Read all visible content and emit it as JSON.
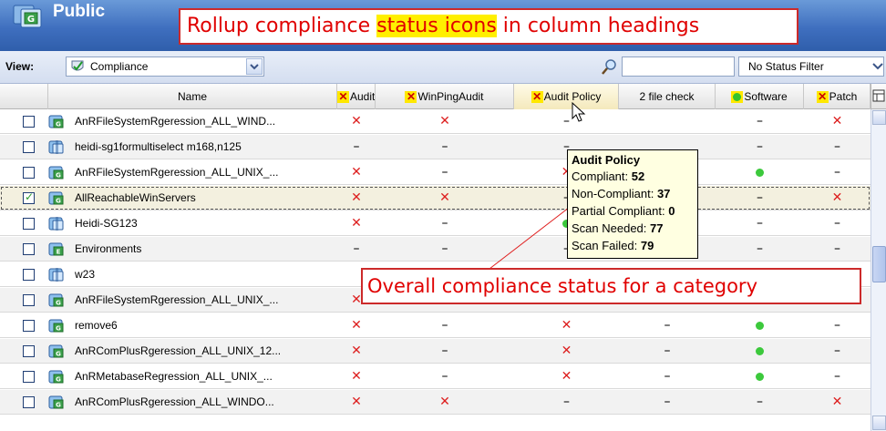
{
  "window": {
    "title": "Public",
    "annotation_top": {
      "before": "Rollup compliance ",
      "highlight": "status icons",
      "after": " in column headings"
    }
  },
  "viewbar": {
    "view_label": "View:",
    "view_value": "Compliance",
    "search_value": "",
    "status_filter": "No Status Filter"
  },
  "columns": [
    {
      "label": "Name",
      "status": "none"
    },
    {
      "label": "Audit",
      "status": "x"
    },
    {
      "label": "WinPingAudit",
      "status": "x"
    },
    {
      "label": "Audit Policy",
      "status": "x"
    },
    {
      "label": "2 file check",
      "status": "none"
    },
    {
      "label": "Software",
      "status": "dot"
    },
    {
      "label": "Patch",
      "status": "x"
    }
  ],
  "rows": [
    {
      "name": "AnRFileSystemRgeression_ALL_WIND...",
      "icon": "group-icon",
      "checked": false,
      "cells": [
        "x",
        "x",
        "-",
        "",
        "-",
        "x"
      ]
    },
    {
      "name": "heidi-sg1formultiselect m168,n125",
      "icon": "smart-group-icon",
      "checked": false,
      "cells": [
        "-",
        "-",
        "-",
        "",
        "-",
        "-"
      ]
    },
    {
      "name": "AnRFileSystemRgeression_ALL_UNIX_...",
      "icon": "group-icon",
      "checked": false,
      "cells": [
        "x",
        "-",
        "x",
        "",
        "dot",
        "-"
      ]
    },
    {
      "name": "AllReachableWinServers",
      "icon": "group-icon",
      "checked": true,
      "cells": [
        "x",
        "x",
        "-",
        "",
        "-",
        "x"
      ]
    },
    {
      "name": "Heidi-SG123",
      "icon": "smart-group-icon",
      "checked": false,
      "cells": [
        "x",
        "-",
        "dot",
        "",
        "-",
        "-"
      ]
    },
    {
      "name": "Environments",
      "icon": "environment-icon",
      "checked": false,
      "cells": [
        "-",
        "-",
        "-",
        "-",
        "-",
        "-"
      ]
    },
    {
      "name": "w23",
      "icon": "smart-group-icon",
      "checked": false,
      "cells": [
        "",
        "",
        "",
        "",
        "",
        ""
      ]
    },
    {
      "name": "AnRFileSystemRgeression_ALL_UNIX_...",
      "icon": "group-icon",
      "checked": false,
      "cells": [
        "x",
        "-",
        "x",
        "-",
        "dot",
        "-"
      ]
    },
    {
      "name": "remove6",
      "icon": "group-icon",
      "checked": false,
      "cells": [
        "x",
        "-",
        "x",
        "-",
        "dot",
        "-"
      ]
    },
    {
      "name": "AnRComPlusRgeression_ALL_UNIX_12...",
      "icon": "group-icon",
      "checked": false,
      "cells": [
        "x",
        "-",
        "x",
        "-",
        "dot",
        "-"
      ]
    },
    {
      "name": "AnRMetabaseRegression_ALL_UNIX_...",
      "icon": "group-icon",
      "checked": false,
      "cells": [
        "x",
        "-",
        "x",
        "-",
        "dot",
        "-"
      ]
    },
    {
      "name": "AnRComPlusRgeression_ALL_WINDO...",
      "icon": "group-icon",
      "checked": false,
      "cells": [
        "x",
        "x",
        "-",
        "-",
        "-",
        "x"
      ]
    }
  ],
  "tooltip": {
    "title": "Audit Policy",
    "lines": [
      {
        "label": "Compliant:",
        "value": "52"
      },
      {
        "label": "Non-Compliant:",
        "value": "37"
      },
      {
        "label": "Partial Compliant:",
        "value": "0"
      },
      {
        "label": "Scan Needed:",
        "value": "77"
      },
      {
        "label": "Scan Failed:",
        "value": "79"
      }
    ]
  },
  "annotation_mid": "Overall compliance status for a category",
  "colors": {
    "annotation_red": "#e00000",
    "highlight_yellow": "#ffef00",
    "status_x": "#dd1f1f",
    "status_dot": "#3cc93c",
    "title_bar": "#3f6fbf"
  }
}
